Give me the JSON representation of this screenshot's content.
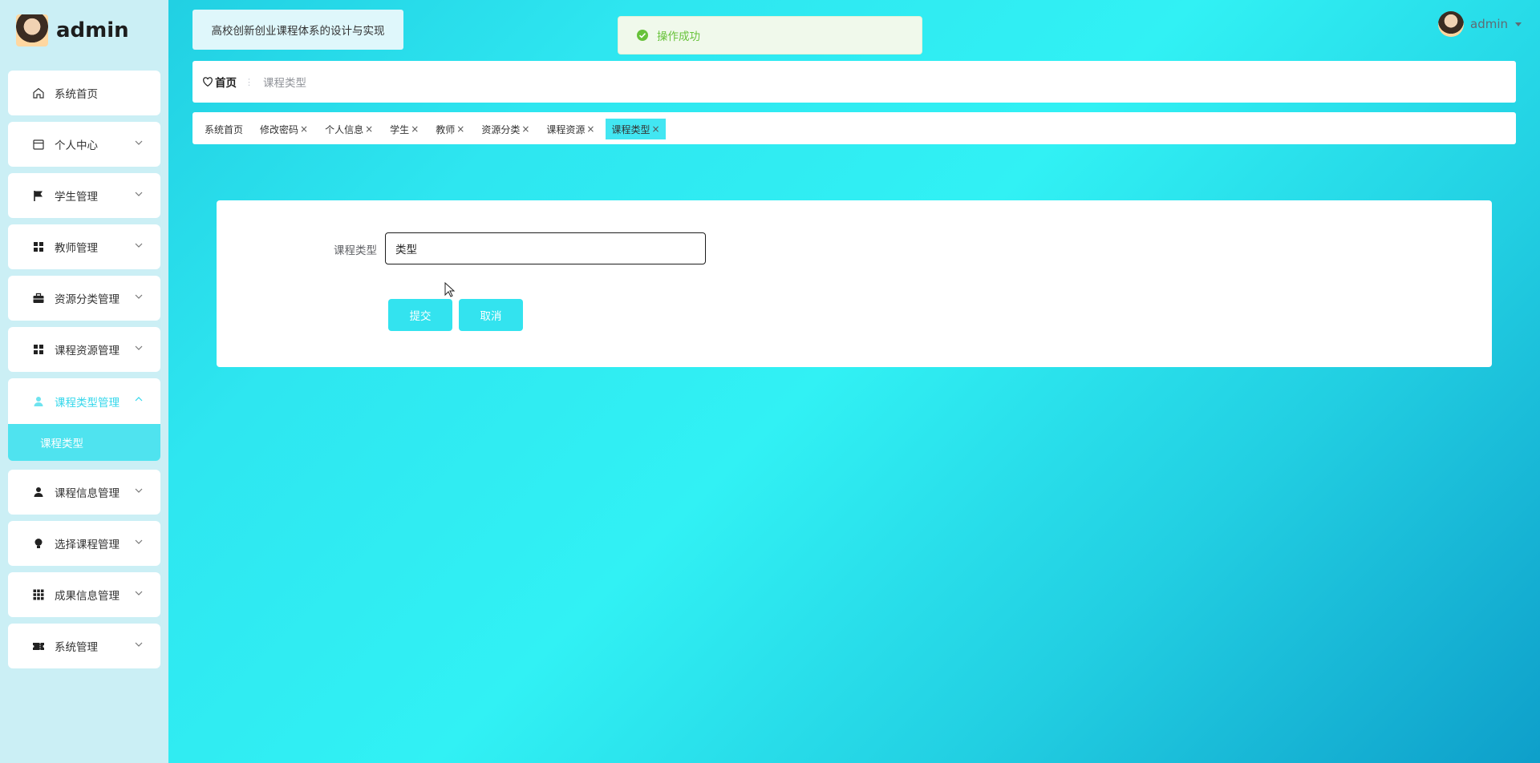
{
  "brand": {
    "name": "admin"
  },
  "header": {
    "app_title": "高校创新创业课程体系的设计与实现",
    "toast": "操作成功",
    "user": "admin"
  },
  "sidebar": {
    "items": [
      {
        "label": "系统首页",
        "icon": "home-icon"
      },
      {
        "label": "个人中心",
        "icon": "calendar-icon"
      },
      {
        "label": "学生管理",
        "icon": "flag-icon"
      },
      {
        "label": "教师管理",
        "icon": "grid-icon"
      },
      {
        "label": "资源分类管理",
        "icon": "briefcase-icon"
      },
      {
        "label": "课程资源管理",
        "icon": "grid-icon"
      },
      {
        "label": "课程类型管理",
        "icon": "user-icon"
      },
      {
        "label": "课程信息管理",
        "icon": "user-icon"
      },
      {
        "label": "选择课程管理",
        "icon": "bulb-icon"
      },
      {
        "label": "成果信息管理",
        "icon": "apps-icon"
      },
      {
        "label": "系统管理",
        "icon": "ticket-icon"
      }
    ],
    "active_sub": "课程类型"
  },
  "breadcrumb": {
    "home": "首页",
    "sep": "⋮",
    "current": "课程类型"
  },
  "tags": [
    {
      "label": "系统首页",
      "closable": false
    },
    {
      "label": "修改密码",
      "closable": true
    },
    {
      "label": "个人信息",
      "closable": true
    },
    {
      "label": "学生",
      "closable": true
    },
    {
      "label": "教师",
      "closable": true
    },
    {
      "label": "资源分类",
      "closable": true
    },
    {
      "label": "课程资源",
      "closable": true
    },
    {
      "label": "课程类型",
      "closable": true
    }
  ],
  "form": {
    "label": "课程类型",
    "value": "类型",
    "submit": "提交",
    "cancel": "取消"
  }
}
